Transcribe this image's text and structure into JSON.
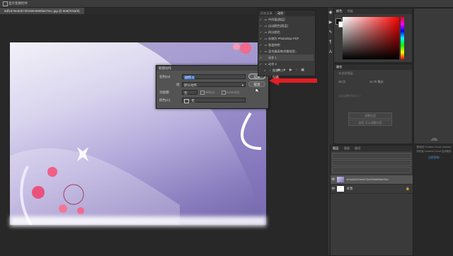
{
  "options_bar": {
    "toggle_label": "显示变换控件"
  },
  "document_tab": {
    "label": "8df1878eb6b73fe3994689fa578cc.jpg @ 808(RGB/8)"
  },
  "actions_panel": {
    "tabs": [
      "历史记录",
      "动作"
    ],
    "items": [
      {
        "label": "中间值(图层)"
      },
      {
        "label": "自动颜色(图层)"
      },
      {
        "label": "四分颜色"
      },
      {
        "label": "存储为 Photoshop PDF"
      },
      {
        "label": "渐变映射"
      },
      {
        "label": "混合器画笔克隆绘图..."
      },
      {
        "label": "动作 1"
      },
      {
        "label": "动作 2"
      },
      {
        "label": "图像大小"
      },
      {
        "label": "存储"
      }
    ]
  },
  "new_action_dialog": {
    "title": "新建动作",
    "name_label": "名称(N):",
    "name_value": "动作 3",
    "set_label": "组:",
    "set_value": "默认动作",
    "function_key_label": "功能键:",
    "function_key_value": "无",
    "shift_label": "Shift(S)",
    "control_label": "Control(O)",
    "color_label": "颜色(C):",
    "color_value": "无",
    "record_button": "记录",
    "cancel_button": "取消"
  },
  "color_panel": {
    "tabs": [
      "颜色",
      "色板"
    ]
  },
  "properties_panel": {
    "title": "属性",
    "subtitle": "未选择图层",
    "font_size": "18 点",
    "leading": "11.75 毫米",
    "note": "自动调整字体大小",
    "buttons": [
      "调整内容",
      "查找 可以调整内容"
    ]
  },
  "cc_libraries": {
    "line1": "要使用 Creative Cloud Libraries",
    "line2": "请安装 Creative Cloud 应用程序",
    "link": "立即获取!"
  },
  "layers_panel": {
    "tabs": [
      "图层",
      "通道",
      "路径"
    ],
    "layers": [
      {
        "name": "8f7ad8f1878eb673fe3994689fa578cc"
      },
      {
        "name": "背景"
      }
    ]
  }
}
